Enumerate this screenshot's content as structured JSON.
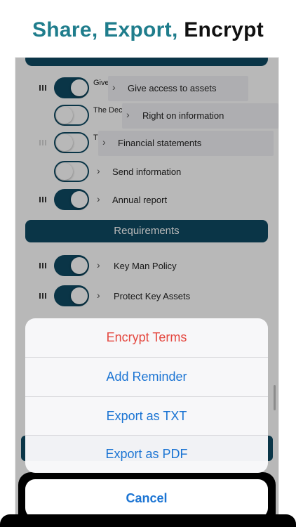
{
  "headline": {
    "part1": "Share, Export, ",
    "part2": "Encrypt"
  },
  "icons": {
    "chevron": "›",
    "drag_handle": "drag-handle-icon"
  },
  "rows": [
    {
      "label": "Give access to assets",
      "underlay": "Give boo",
      "enabled": true
    },
    {
      "label": "Right on information",
      "underlay": "The Dec operatio",
      "enabled": false
    },
    {
      "label": "Financial statements",
      "underlay": "T a",
      "enabled": false
    },
    {
      "label": "Send information",
      "enabled": false
    },
    {
      "label": "Annual report",
      "enabled": true
    },
    {
      "label": "Key Man Policy",
      "enabled": true
    },
    {
      "label": "Protect Key Assets",
      "enabled": true
    }
  ],
  "section": {
    "requirements": "Requirements"
  },
  "sheet": {
    "actions": [
      "Encrypt Terms",
      "Add Reminder",
      "Export as TXT",
      "Export as PDF"
    ],
    "cancel": "Cancel"
  },
  "colors": {
    "accent": "#0e4a63",
    "headline_teal": "#1f7d8c",
    "action_blue": "#1b74d3",
    "destructive_red": "#e4473f"
  }
}
